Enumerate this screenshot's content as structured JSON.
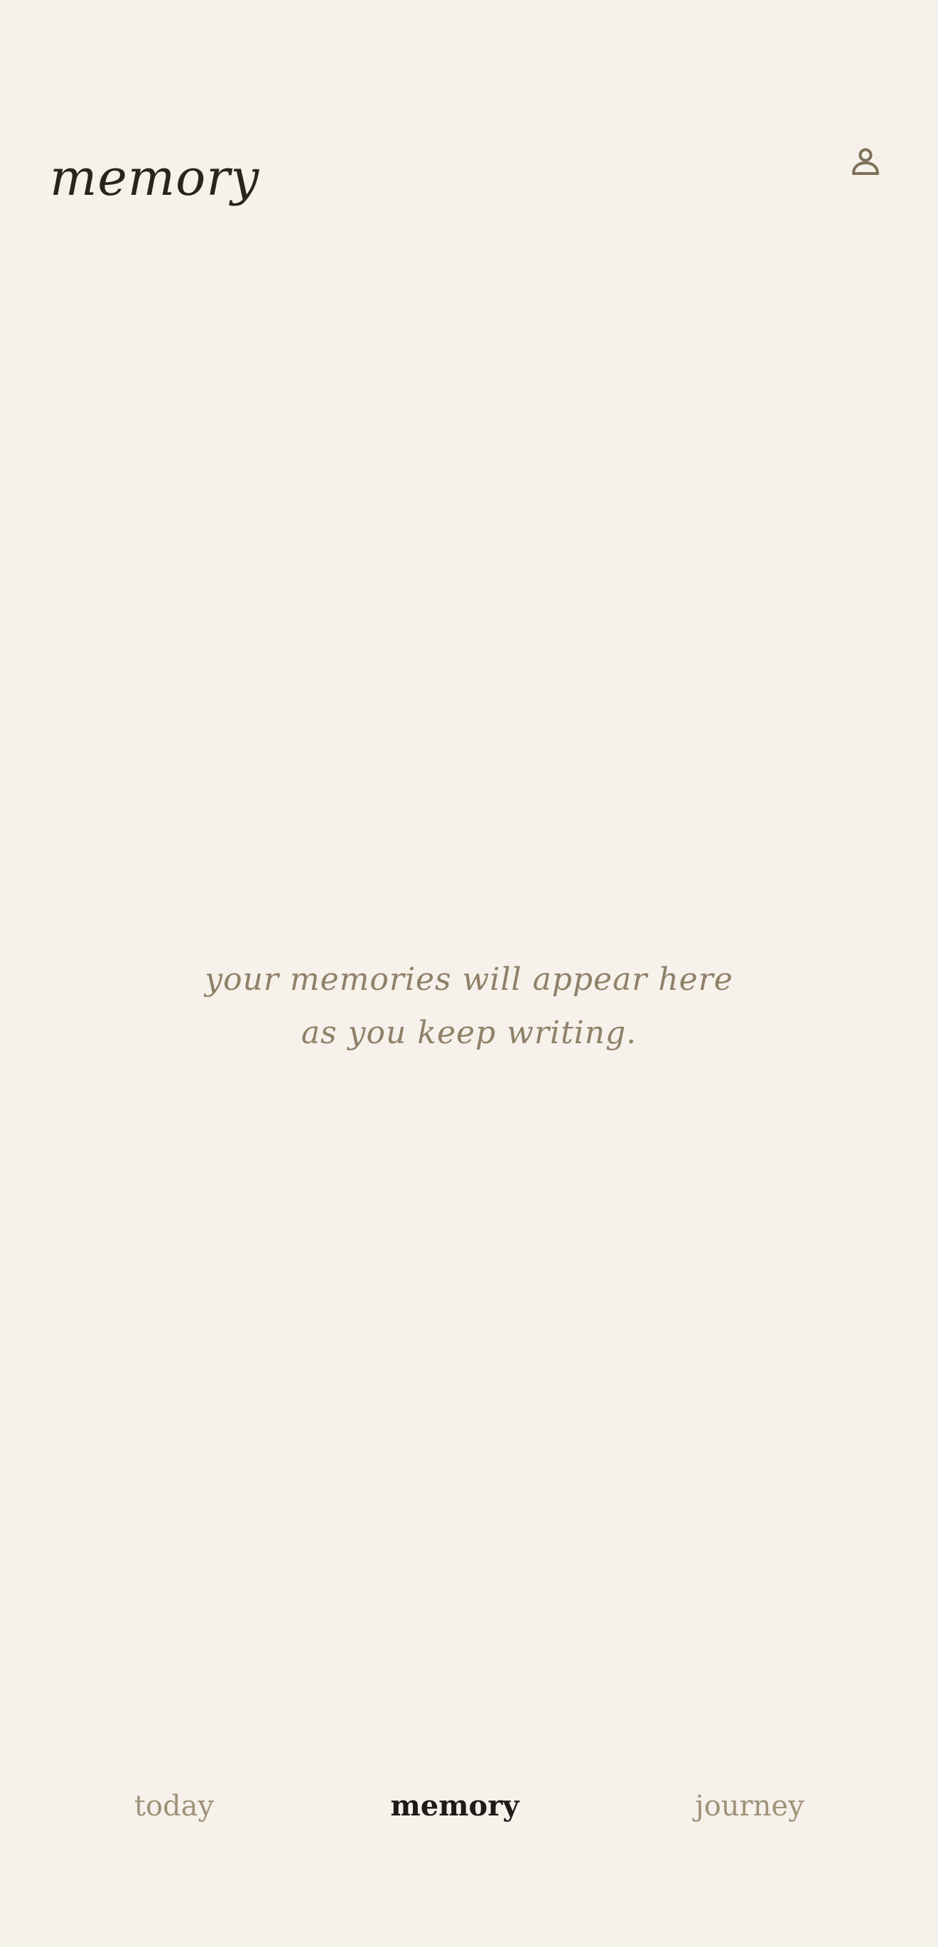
{
  "header": {
    "title": "memory",
    "profile_icon": "user-icon"
  },
  "empty_state": {
    "line1": "your memories will appear here",
    "line2": "as you keep writing."
  },
  "bottom_nav": {
    "tabs": [
      {
        "label": "today",
        "active": false
      },
      {
        "label": "memory",
        "active": true
      },
      {
        "label": "journey",
        "active": false
      }
    ]
  },
  "colors": {
    "background": "#f6f1ea",
    "title_text": "#2b241d",
    "muted_text": "#8f8068",
    "inactive_tab": "#a09279",
    "active_tab": "#1e1a16",
    "icon": "#7e7058"
  }
}
